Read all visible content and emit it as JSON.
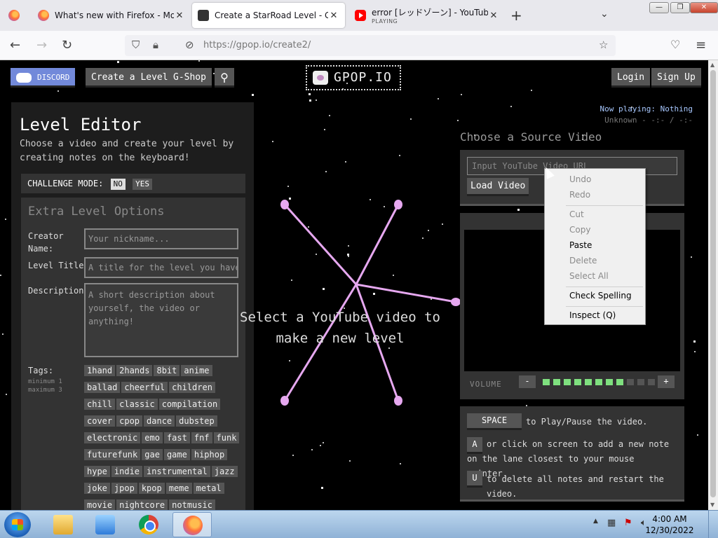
{
  "browser": {
    "tabs": [
      {
        "title": "What's new with Firefox - More",
        "icon": "firefox-icon"
      },
      {
        "title": "Create a StarRoad Level - Gpop.",
        "icon": "gpop-icon"
      },
      {
        "title": "error [レッドゾーン] - YouTube",
        "subtitle": "PLAYING",
        "icon": "youtube-icon"
      }
    ],
    "new_tab": "+",
    "url": "https://gpop.io/create2/"
  },
  "site": {
    "discord_label": "DISCORD",
    "create_level": "Create a Level",
    "gshop": "G-Shop",
    "logo": "GPOP.IO",
    "login": "Login",
    "signup": "Sign Up",
    "now_playing": "Now playing: Nothing",
    "now_playing_sub": "Unknown - -:- / -:-"
  },
  "editor": {
    "title": "Level Editor",
    "description": "Choose a video and create your level by creating notes on the keyboard!",
    "challenge_label": "CHALLENGE MODE:",
    "challenge_no": "NO",
    "challenge_yes": "YES",
    "extra_title": "Extra Level Options",
    "creator_label": "Creator Name:",
    "creator_placeholder": "Your nickname...",
    "level_title_label": "Level Title:",
    "level_title_placeholder": "A title for the level you have cr",
    "description_label": "Description:",
    "description_placeholder": "A short description about yourself, the video or anything!",
    "tags_label": "Tags:",
    "tags_min": "minimum 1",
    "tags_max": "maximum 3",
    "tags": [
      "1hand",
      "2hands",
      "8bit",
      "anime",
      "ballad",
      "cheerful",
      "children",
      "chill",
      "classic",
      "compilation",
      "cover",
      "cpop",
      "dance",
      "dubstep",
      "electronic",
      "emo",
      "fast",
      "fnf",
      "funk",
      "futurefunk",
      "gae",
      "game",
      "hiphop",
      "hype",
      "indie",
      "instrumental",
      "jazz",
      "joke",
      "jpop",
      "kpop",
      "meme",
      "metal",
      "movie",
      "nightcore",
      "notmusic"
    ]
  },
  "center": {
    "line1": "Select a YouTube video to",
    "line2": "make a new level"
  },
  "source": {
    "title": "Choose a Source Video",
    "input_placeholder": "Input YouTube Video URL",
    "load_button": "Load Video",
    "volume_label": "VOLUME",
    "volume_minus": "-",
    "volume_plus": "+",
    "volume_level": 8,
    "volume_steps": 11
  },
  "help": {
    "space_key": "SPACE",
    "space_text": "to Play/Pause the video.",
    "a_key": "A",
    "a_text": "or click on screen to add a new note on the lane closest to your mouse pointer.",
    "u_key": "U",
    "u_text": "to delete all notes and restart the video."
  },
  "context_menu": {
    "undo": "Undo",
    "redo": "Redo",
    "cut": "Cut",
    "copy": "Copy",
    "paste": "Paste",
    "delete": "Delete",
    "select_all": "Select All",
    "check_spelling": "Check Spelling",
    "inspect": "Inspect (Q)"
  },
  "taskbar": {
    "time": "4:00 AM",
    "date": "12/30/2022"
  },
  "colors": {
    "discord": "#7289da",
    "lane_line": "#e6a8f0",
    "volume_on": "#7fe07f",
    "volume_off": "#555555"
  }
}
